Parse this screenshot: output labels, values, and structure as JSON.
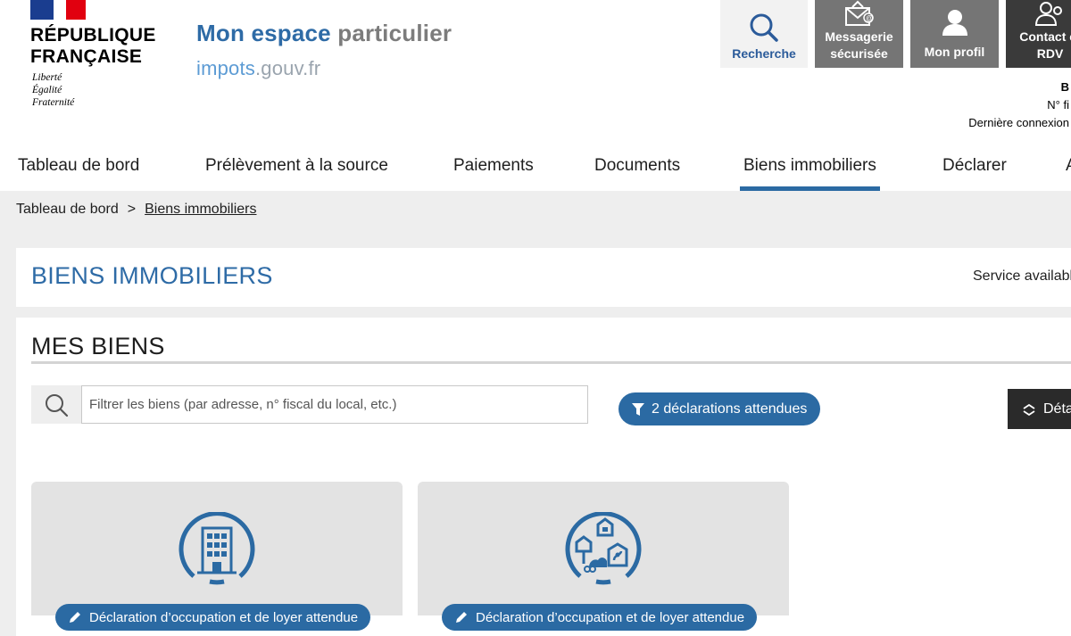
{
  "header": {
    "republic_line1": "RÉPUBLIQUE",
    "republic_line2": "FRANÇAISE",
    "motto_1": "Liberté",
    "motto_2": "Égalité",
    "motto_3": "Fraternité",
    "app_title_1": "Mon espace",
    "app_title_2": "particulier",
    "site_1": "impots",
    "site_2": ".gouv.fr",
    "buttons": {
      "search": "Recherche",
      "messaging_1": "Messagerie",
      "messaging_2": "sécurisée",
      "profile": "Mon profil",
      "contact_1": "Contact et",
      "contact_2": "RDV"
    },
    "user_info": {
      "line1": "B",
      "line2": "N° fi",
      "line3": "Dernière connexion"
    }
  },
  "nav": {
    "items": [
      {
        "label": "Tableau de bord"
      },
      {
        "label": "Prélèvement à la source"
      },
      {
        "label": "Paiements"
      },
      {
        "label": "Documents"
      },
      {
        "label": "Biens immobiliers"
      },
      {
        "label": "Déclarer"
      },
      {
        "label": "A"
      }
    ],
    "active": "Biens immobiliers"
  },
  "breadcrumb": {
    "home": "Tableau de bord",
    "separator": ">",
    "current": "Biens immobiliers"
  },
  "page": {
    "title": "BIENS IMMOBILIERS",
    "service_text": "Service availabl",
    "section_title": "MES BIENS",
    "filter_placeholder": "Filtrer les biens (par adresse, n° fiscal du local, etc.)",
    "declarations_pill": "2 déclarations attendues",
    "detail_button": "Déta"
  },
  "cards": [
    {
      "icon": "apartment-building-icon",
      "action": "Déclaration d’occupation et de loyer attendue"
    },
    {
      "icon": "multiple-properties-icon",
      "action": "Déclaration d’occupation et de loyer attendue"
    }
  ],
  "colors": {
    "primary_blue": "#2b6aa3",
    "title_blue": "#2e6ba6",
    "header_gray": "#757575",
    "header_dark": "#3a3a3a",
    "marianne_blue": "#1a3d8f",
    "marianne_red": "#e1000f"
  }
}
